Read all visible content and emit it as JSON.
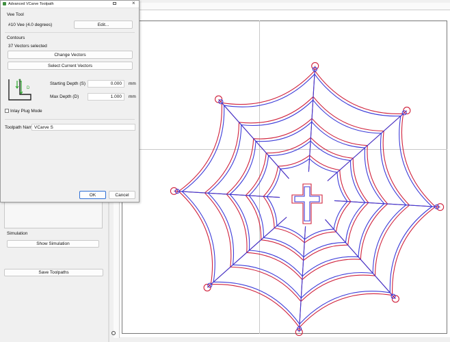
{
  "dialog": {
    "title": "Advanced VCarve Toolpath",
    "vee_tool_heading": "Vee Tool",
    "tool_name": "#10 Vee (4.0 degrees)",
    "edit_label": "Edit...",
    "contours_heading": "Contours",
    "vectors_selected": "37 Vectors selected",
    "change_vectors_label": "Change Vectors",
    "select_current_label": "Select Current Vectors",
    "diagram_s": "S",
    "diagram_d": "D",
    "starting_depth_label": "Starting Depth (S)",
    "starting_depth_value": "0.000",
    "starting_depth_unit": "mm",
    "max_depth_label": "Max Depth (D)",
    "max_depth_value": "1.000",
    "max_depth_unit": "mm",
    "inlay_label": "Inlay Plug Mode",
    "inlay_checked": false,
    "toolpath_name_label": "Toolpath Name",
    "toolpath_name_value": "VCarve S",
    "ok_label": "OK",
    "cancel_label": "Cancel"
  },
  "sidebar": {
    "simulation_heading": "Simulation",
    "show_simulation_label": "Show Simulation",
    "save_toolpaths_label": "Save Toolpaths"
  },
  "canvas": {
    "background": "#ffffff",
    "web_color_outer": "#d0203a",
    "web_color_inner": "#3a3ad8"
  }
}
